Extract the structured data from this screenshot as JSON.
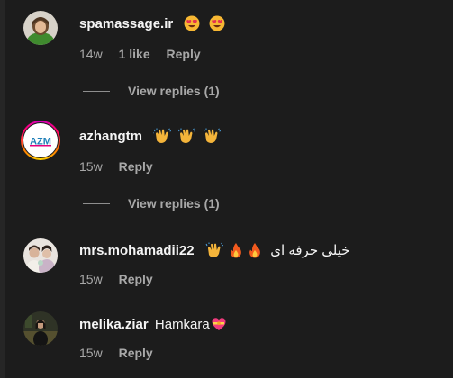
{
  "comments": [
    {
      "username": "spamassage.ir",
      "text": "",
      "emojis": [
        "heart-eyes",
        "heart-eyes"
      ],
      "time": "14w",
      "likes": "1 like",
      "reply": "Reply"
    },
    {
      "username": "azhangtm",
      "text": "",
      "emojis": [
        "clapping-hands",
        "clapping-hands",
        "clapping-hands"
      ],
      "time": "15w",
      "likes": "",
      "reply": "Reply",
      "avatar_text": "AZM"
    },
    {
      "username": "mrs.mohamadii22",
      "text": "خیلی حرفه ای",
      "emojis": [
        "clapping-hands",
        "fire",
        "fire"
      ],
      "time": "15w",
      "likes": "",
      "reply": "Reply"
    },
    {
      "username": "melika.ziar",
      "text": "Hamkara",
      "emojis": [
        "heart-with-ribbon"
      ],
      "time": "15w",
      "likes": "",
      "reply": "Reply"
    }
  ],
  "view_replies": [
    {
      "label": "View replies (1)"
    },
    {
      "label": "View replies (1)"
    }
  ],
  "colors": {
    "background": "#1c1c1c",
    "primary_text": "#f5f5f5",
    "secondary_text": "#a8a8a8"
  }
}
